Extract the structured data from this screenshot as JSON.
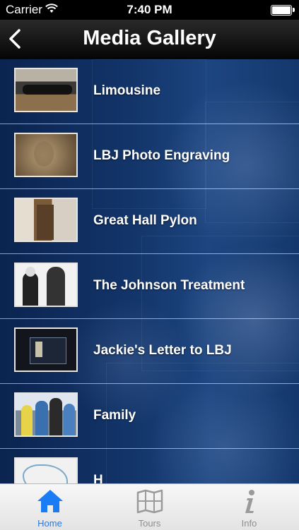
{
  "status_bar": {
    "carrier": "Carrier",
    "time": "7:40 PM"
  },
  "nav": {
    "title": "Media Gallery",
    "back_icon": "chevron-left-icon"
  },
  "gallery": {
    "items": [
      {
        "label": "Limousine",
        "thumb": "limousine-photo"
      },
      {
        "label": "LBJ Photo Engraving",
        "thumb": "engraving-photo"
      },
      {
        "label": "Great Hall Pylon",
        "thumb": "pylon-photo"
      },
      {
        "label": "The Johnson Treatment",
        "thumb": "johnson-treatment-photo"
      },
      {
        "label": "Jackie's Letter to LBJ",
        "thumb": "letter-case-photo"
      },
      {
        "label": "Family",
        "thumb": "family-photo"
      },
      {
        "label": "H",
        "thumb": "sketch-photo"
      }
    ]
  },
  "tabs": [
    {
      "label": "Home",
      "icon": "house-icon",
      "active": true
    },
    {
      "label": "Tours",
      "icon": "map-icon",
      "active": false
    },
    {
      "label": "Info",
      "icon": "info-icon",
      "active": false
    }
  ],
  "colors": {
    "accent": "#1a7cf5",
    "tab_inactive": "#8e8e93"
  }
}
